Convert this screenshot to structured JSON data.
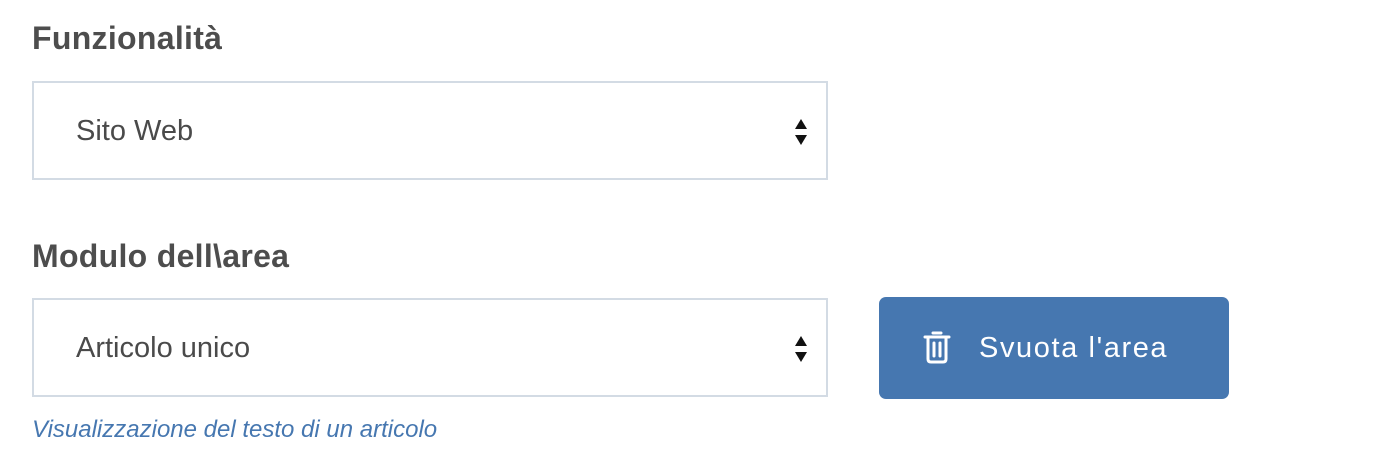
{
  "funzionalita": {
    "label": "Funzionalità",
    "selected": "Sito Web"
  },
  "modulo": {
    "label": "Modulo dell\\area",
    "selected": "Articolo unico",
    "help": "Visualizzazione del testo di un articolo"
  },
  "clear_button": {
    "label": "Svuota l'area",
    "icon": "trash-icon"
  },
  "colors": {
    "accent": "#4677b0",
    "label_text": "#4d4d4d",
    "border": "#d3dbe4"
  }
}
